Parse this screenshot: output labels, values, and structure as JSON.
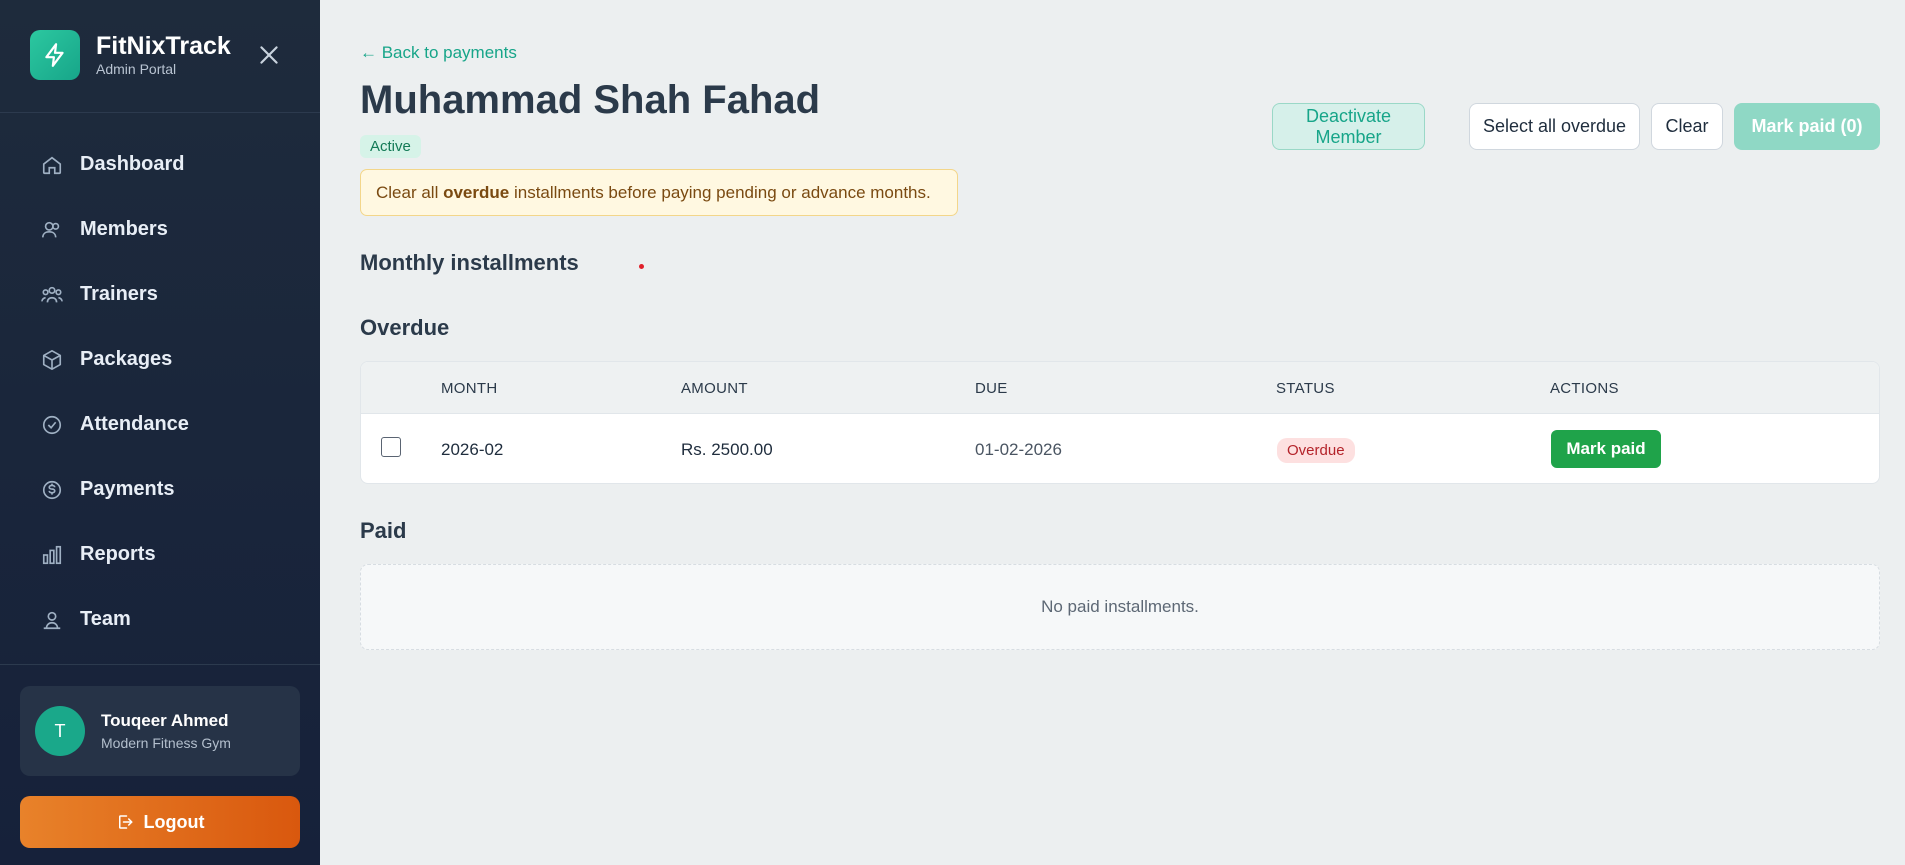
{
  "app": {
    "title": "FitNixTrack",
    "subtitle": "Admin Portal"
  },
  "sidebar": {
    "items": [
      {
        "label": "Dashboard",
        "icon": "home-icon"
      },
      {
        "label": "Members",
        "icon": "users-icon"
      },
      {
        "label": "Trainers",
        "icon": "group-icon"
      },
      {
        "label": "Packages",
        "icon": "box-icon"
      },
      {
        "label": "Attendance",
        "icon": "check-circle-icon"
      },
      {
        "label": "Payments",
        "icon": "dollar-icon"
      },
      {
        "label": "Reports",
        "icon": "bar-chart-icon"
      },
      {
        "label": "Team",
        "icon": "team-icon"
      }
    ],
    "user": {
      "initial": "T",
      "name": "Touqeer Ahmed",
      "org": "Modern Fitness Gym"
    },
    "logout_label": "Logout"
  },
  "main": {
    "back_link": "← Back to payments",
    "member_name": "Muhammad Shah Fahad",
    "status_badge": "Active",
    "warning": {
      "prefix": "Clear all ",
      "bold": "overdue",
      "suffix": " installments before paying pending or advance months."
    },
    "actions": {
      "deactivate": "Deactivate Member",
      "select_all": "Select all overdue",
      "clear": "Clear",
      "mark_paid_all": "Mark paid (0)"
    },
    "section_title": "Monthly installments",
    "overdue": {
      "title": "Overdue",
      "columns": [
        "MONTH",
        "AMOUNT",
        "DUE",
        "STATUS",
        "ACTIONS"
      ],
      "rows": [
        {
          "month": "2026-02",
          "amount": "Rs. 2500.00",
          "due": "01-02-2026",
          "status": "Overdue",
          "action": "Mark paid"
        }
      ]
    },
    "paid": {
      "title": "Paid",
      "empty": "No paid installments."
    }
  },
  "colors": {
    "accent": "#17a589",
    "sidebar_bg": "#1e2b3c",
    "logout": "#e07020",
    "mark_paid": "#1fa34a",
    "overdue": "#b4232a"
  }
}
